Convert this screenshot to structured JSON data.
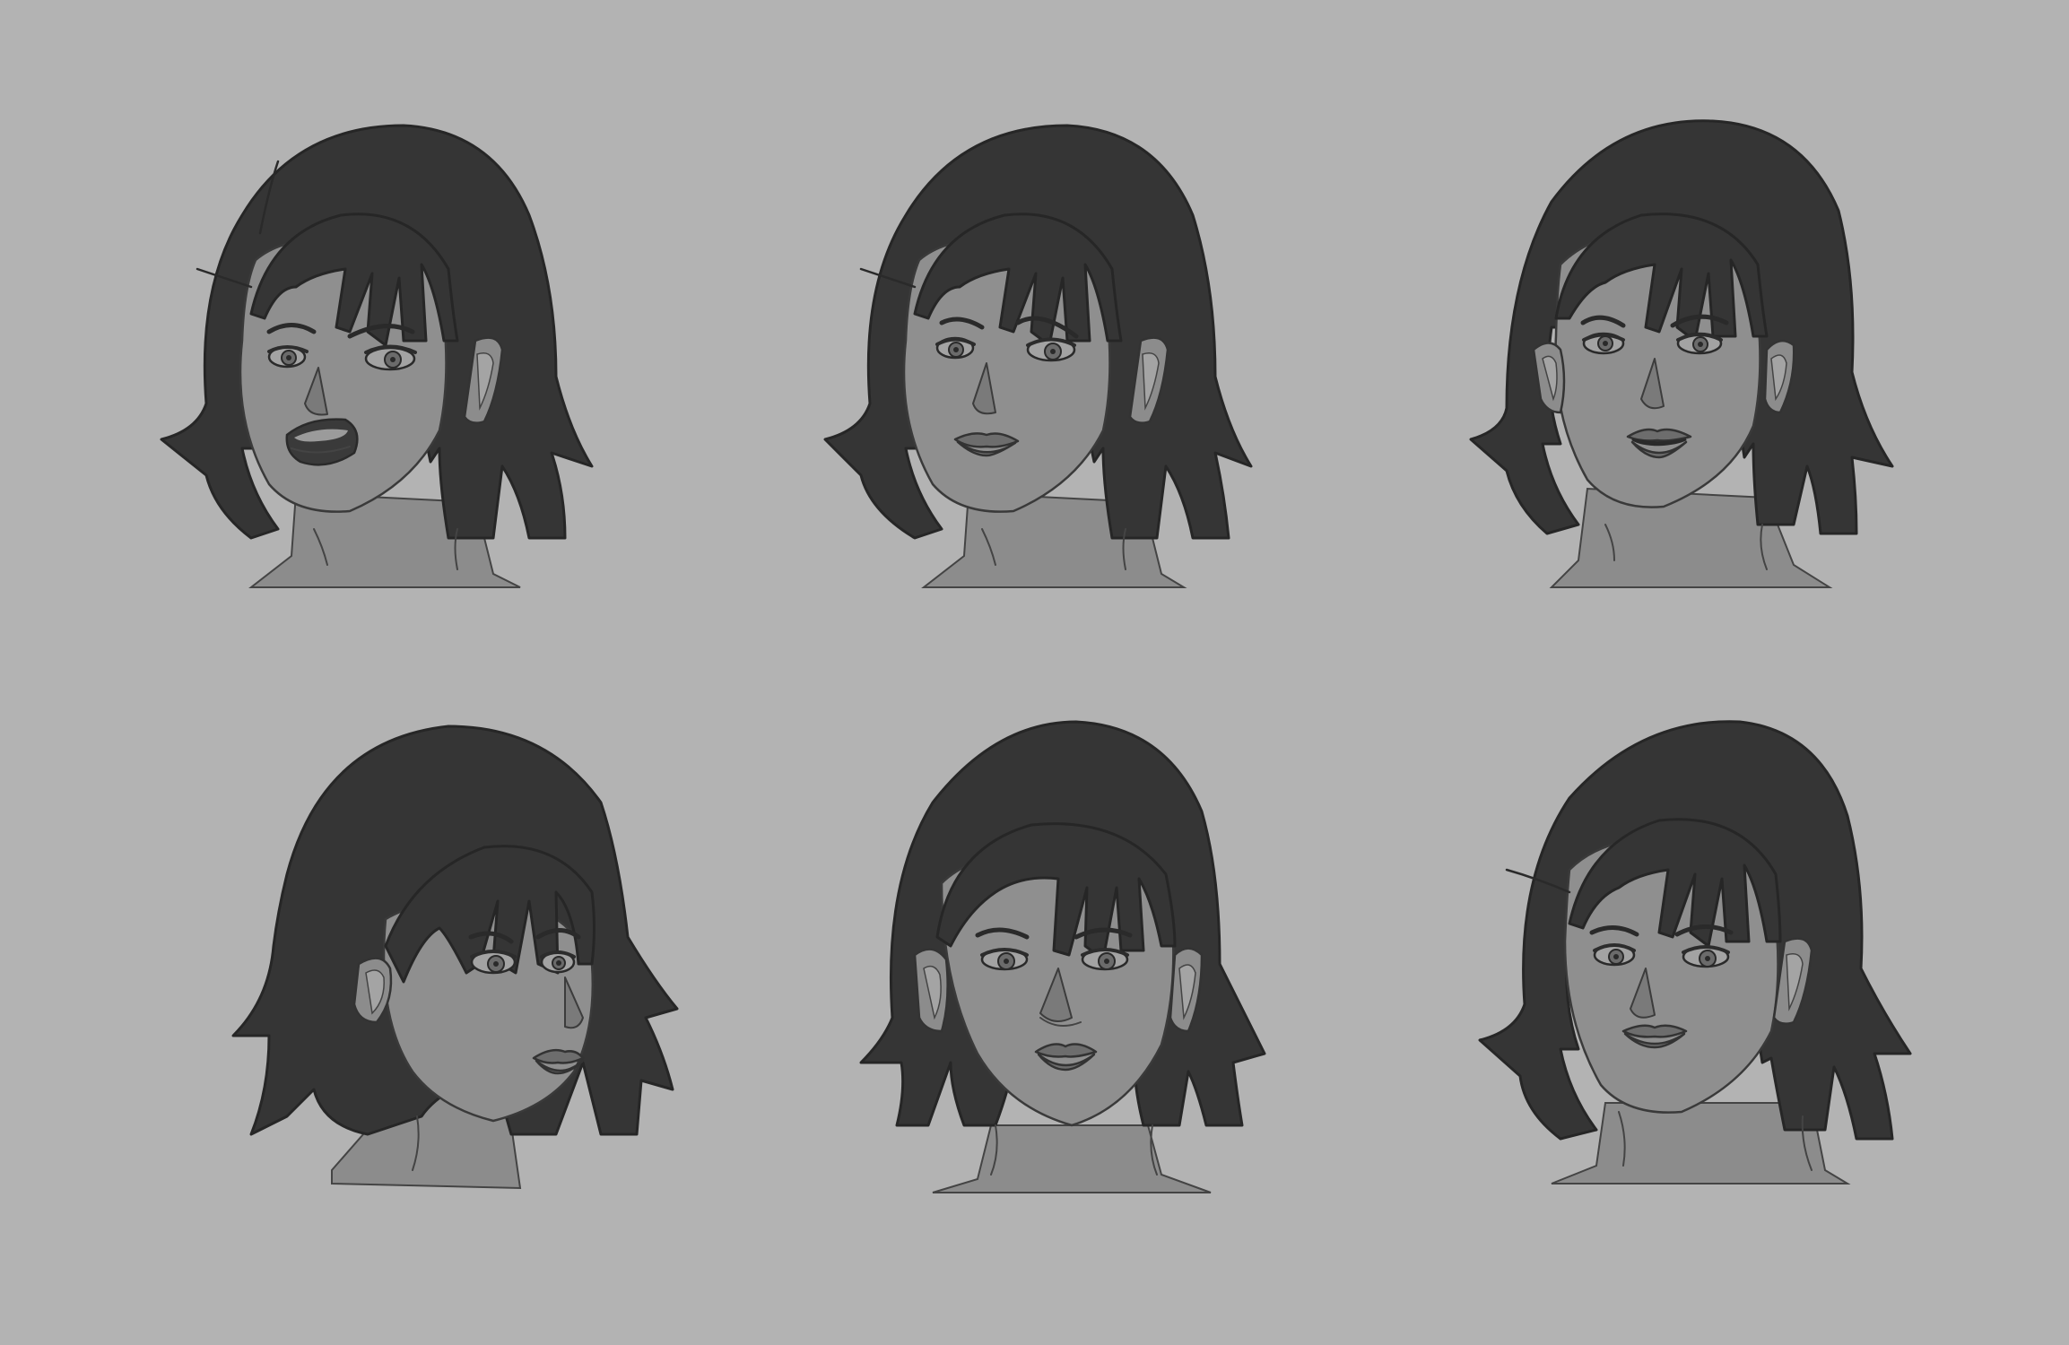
{
  "canvas": {
    "background": "#b3b3b3",
    "hair_color": "#353535",
    "skin_color": "#8f8f8f"
  },
  "faces": [
    {
      "id": "face-1",
      "expression": "shouting",
      "mouth": "open",
      "turn": "left"
    },
    {
      "id": "face-2",
      "expression": "worried",
      "mouth": "closed",
      "turn": "left"
    },
    {
      "id": "face-3",
      "expression": "sad",
      "mouth": "parted",
      "turn": "front"
    },
    {
      "id": "face-4",
      "expression": "neutral",
      "mouth": "closed",
      "turn": "right"
    },
    {
      "id": "face-5",
      "expression": "neutral",
      "mouth": "closed",
      "turn": "front"
    },
    {
      "id": "face-6",
      "expression": "slight-smile",
      "mouth": "closed",
      "turn": "left"
    }
  ]
}
